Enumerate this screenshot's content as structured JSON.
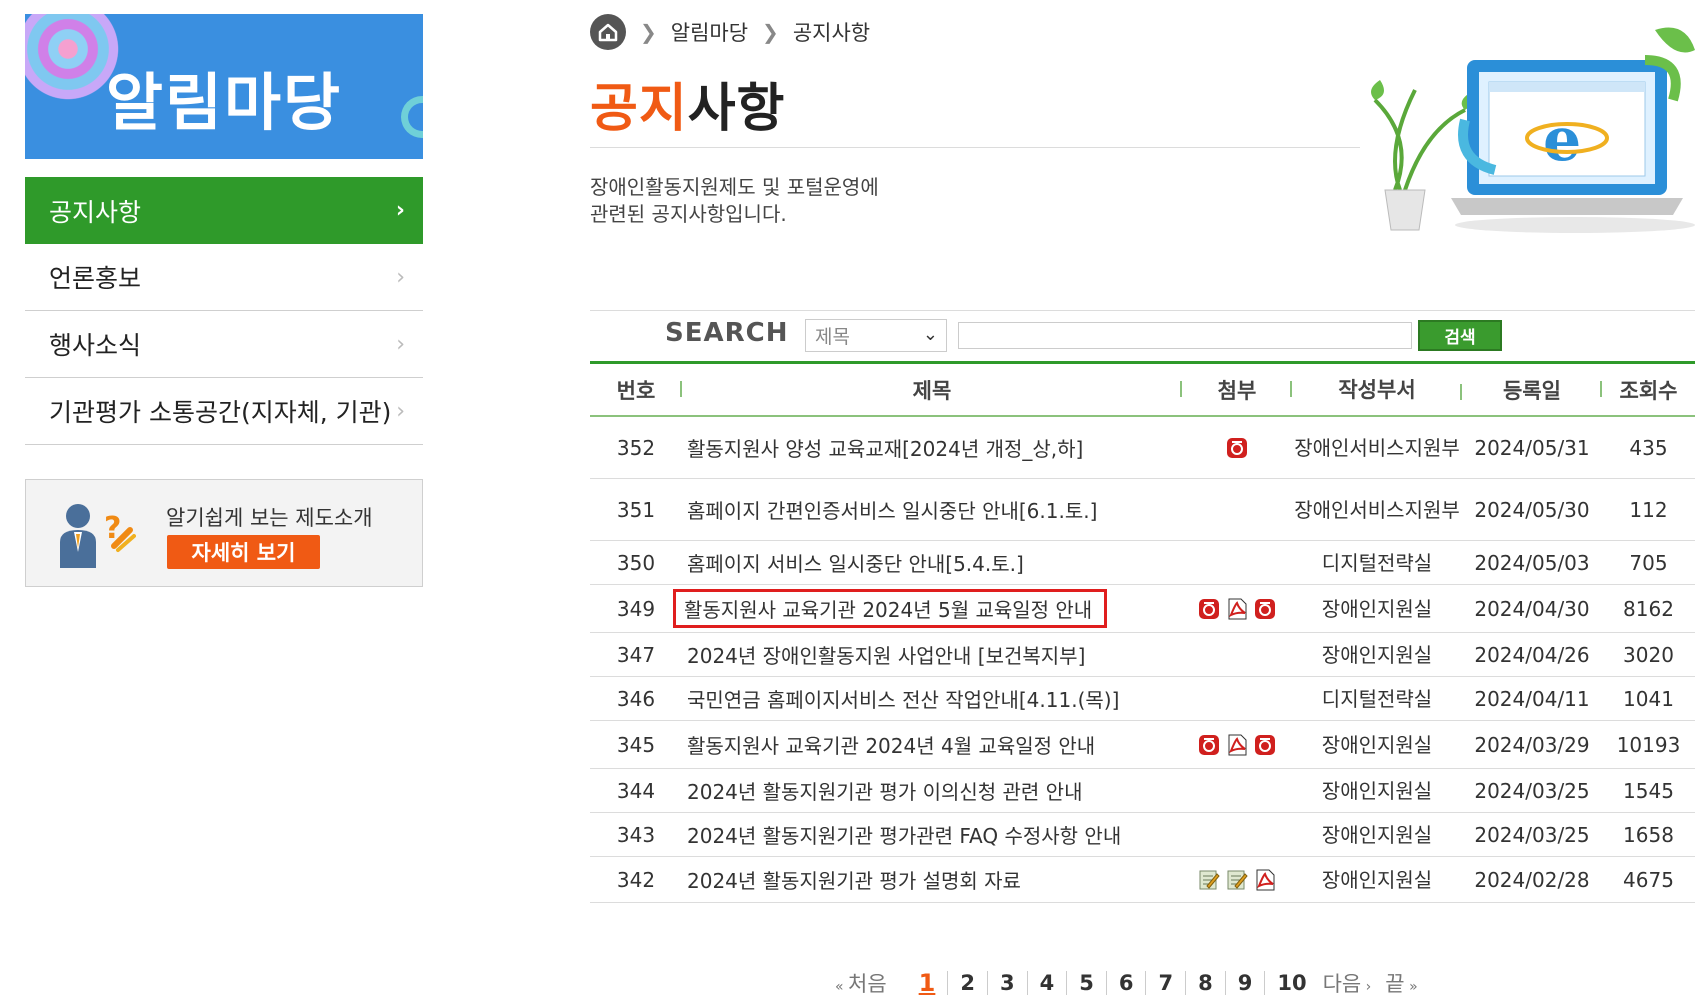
{
  "sidebar": {
    "banner_title": "알림마당",
    "menu": [
      {
        "label": "공지사항",
        "active": true
      },
      {
        "label": "언론홍보",
        "active": false
      },
      {
        "label": "행사소식",
        "active": false
      },
      {
        "label": "기관평가 소통공간(지자체, 기관)",
        "active": false
      }
    ],
    "intro": {
      "text": "알기쉽게 보는 제도소개",
      "button": "자세히 보기"
    }
  },
  "breadcrumb": [
    "알림마당",
    "공지사항"
  ],
  "page": {
    "title_accent": "공지",
    "title_rest": "사항",
    "description_line1": "장애인활동지원제도 및 포털운영에",
    "description_line2": "관련된 공지사항입니다."
  },
  "search": {
    "label": "SEARCH",
    "select_value": "제목",
    "input_value": "",
    "button": "검색"
  },
  "table": {
    "headers": [
      "번호",
      "제목",
      "첨부",
      "작성부서",
      "등록일",
      "조회수"
    ],
    "rows": [
      {
        "no": "352",
        "title": "활동지원사 양성 교육교재[2024년 개정_상,하]",
        "attachments": [
          "hwp-icon"
        ],
        "dept": "장애인서비스지원부",
        "date": "2024/05/31",
        "views": "435"
      },
      {
        "no": "351",
        "title": "홈페이지 간편인증서비스 일시중단 안내[6.1.토.]",
        "attachments": [],
        "dept": "장애인서비스지원부",
        "date": "2024/05/30",
        "views": "112"
      },
      {
        "no": "350",
        "title": "홈페이지 서비스 일시중단 안내[5.4.토.]",
        "attachments": [],
        "dept": "디지털전략실",
        "date": "2024/05/03",
        "views": "705"
      },
      {
        "no": "349",
        "title": "활동지원사 교육기관 2024년 5월 교육일정 안내",
        "attachments": [
          "hwp-icon",
          "pdf-icon",
          "hwp-icon"
        ],
        "dept": "장애인지원실",
        "date": "2024/04/30",
        "views": "8162",
        "highlighted": true
      },
      {
        "no": "347",
        "title": "2024년 장애인활동지원 사업안내 [보건복지부]",
        "attachments": [],
        "dept": "장애인지원실",
        "date": "2024/04/26",
        "views": "3020"
      },
      {
        "no": "346",
        "title": "국민연금 홈페이지서비스 전산 작업안내[4.11.(목)]",
        "attachments": [],
        "dept": "디지털전략실",
        "date": "2024/04/11",
        "views": "1041"
      },
      {
        "no": "345",
        "title": "활동지원사 교육기관 2024년 4월 교육일정 안내",
        "attachments": [
          "hwp-icon",
          "pdf-icon",
          "hwp-icon"
        ],
        "dept": "장애인지원실",
        "date": "2024/03/29",
        "views": "10193"
      },
      {
        "no": "344",
        "title": "2024년 활동지원기관 평가 이의신청 관련 안내",
        "attachments": [],
        "dept": "장애인지원실",
        "date": "2024/03/25",
        "views": "1545"
      },
      {
        "no": "343",
        "title": "2024년 활동지원기관 평가관련 FAQ 수정사항 안내",
        "attachments": [],
        "dept": "장애인지원실",
        "date": "2024/03/25",
        "views": "1658"
      },
      {
        "no": "342",
        "title": "2024년 활동지원기관 평가 설명회 자료",
        "attachments": [
          "doc-icon",
          "doc-icon",
          "pdf-icon"
        ],
        "dept": "장애인지원실",
        "date": "2024/02/28",
        "views": "4675"
      }
    ]
  },
  "pagination": {
    "first": "처음",
    "pages": [
      "1",
      "2",
      "3",
      "4",
      "5",
      "6",
      "7",
      "8",
      "9",
      "10"
    ],
    "current": "1",
    "next": "다음",
    "last": "끝"
  },
  "colors": {
    "accent_orange": "#f05a14",
    "menu_green": "#2f9a2a",
    "banner_blue": "#3a8fe0",
    "highlight_red": "#e01e1e"
  }
}
